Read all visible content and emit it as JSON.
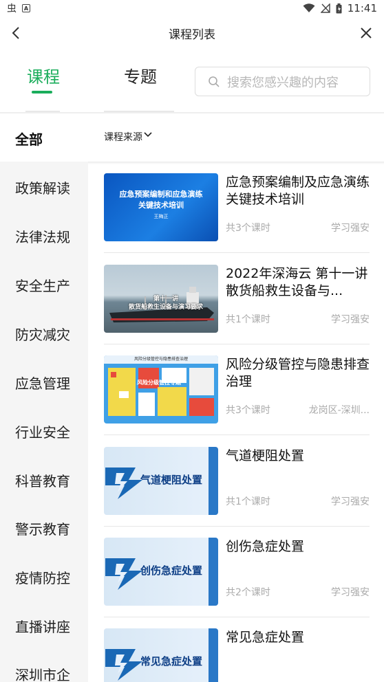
{
  "status_bar": {
    "left_glyph": "虫",
    "left_box": "A",
    "time": "11:41"
  },
  "header": {
    "title": "课程列表"
  },
  "tabs": [
    {
      "label": "课程",
      "active": true
    },
    {
      "label": "专题",
      "active": false
    }
  ],
  "search": {
    "placeholder": "搜索您感兴趣的内容"
  },
  "sidebar": {
    "all_label": "全部",
    "items": [
      "政策解读",
      "法律法规",
      "安全生产",
      "防灾减灾",
      "应急管理",
      "行业安全",
      "科普教育",
      "警示教育",
      "疫情防控",
      "直播讲座",
      "深圳市企"
    ]
  },
  "filter": {
    "label": "课程来源"
  },
  "courses": [
    {
      "title": "应急预案编制及应急演练关键技术培训",
      "count": "共3个课时",
      "source": "学习强安",
      "thumb_line1": "应急预案编制和应急演练",
      "thumb_line2": "关键技术培训",
      "thumb_small": "王梅正"
    },
    {
      "title": "2022年深海云 第十一讲 散货船救生设备与...",
      "count": "共1个课时",
      "source": "学习强安",
      "thumb_line1": "第十一讲",
      "thumb_line2": "散货船救生设备与演习要求"
    },
    {
      "title": "风险分级管控与隐患排查治理",
      "count": "共3个课时",
      "source": "龙岗区-深圳...",
      "thumb_head": "风险分级管控与隐患排查治理",
      "thumb_line1": "风险分级管控专题"
    },
    {
      "title": "气道梗阻处置",
      "count": "共1个课时",
      "source": "学习强安",
      "thumb_text": "气道梗阻处置"
    },
    {
      "title": "创伤急症处置",
      "count": "共2个课时",
      "source": "学习强安",
      "thumb_text": "创伤急症处置"
    },
    {
      "title": "常见急症处置",
      "count": "",
      "source": "",
      "thumb_text": "常见急症处置"
    }
  ],
  "colors": {
    "accent": "#1aad5b",
    "sidebar_bg": "#f5f5f5"
  }
}
